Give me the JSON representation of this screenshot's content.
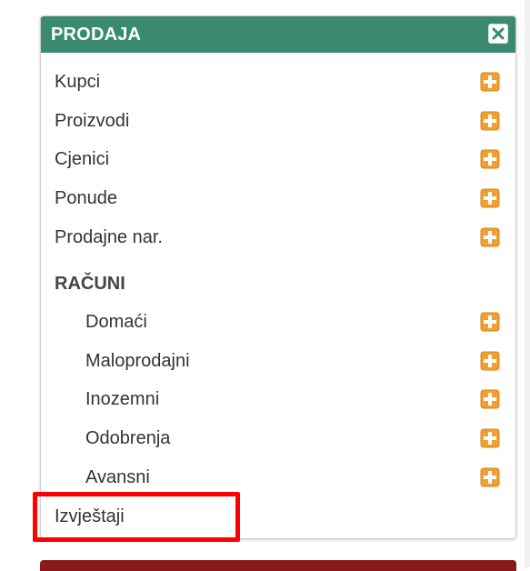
{
  "panel": {
    "title": "PRODAJA",
    "close_icon": "close-icon",
    "header_color": "#3a8a72"
  },
  "menu": [
    {
      "label": "Kupci",
      "icon": "plus-icon"
    },
    {
      "label": "Proizvodi",
      "icon": "plus-icon"
    },
    {
      "label": "Cjenici",
      "icon": "plus-icon"
    },
    {
      "label": "Ponude",
      "icon": "plus-icon"
    },
    {
      "label": "Prodajne nar.",
      "icon": "plus-icon"
    }
  ],
  "racuni": {
    "heading": "RAČUNI",
    "items": [
      {
        "label": "Domaći",
        "icon": "plus-icon"
      },
      {
        "label": "Maloprodajni",
        "icon": "plus-icon"
      },
      {
        "label": "Inozemni",
        "icon": "plus-icon"
      },
      {
        "label": "Odobrenja",
        "icon": "plus-icon"
      },
      {
        "label": "Avansni",
        "icon": "plus-icon"
      }
    ]
  },
  "reports": {
    "label": "Izvještaji"
  },
  "colors": {
    "plus_icon": "#f0a030",
    "highlight": "#ff0000",
    "next_panel_header": "#8a1a1a"
  }
}
